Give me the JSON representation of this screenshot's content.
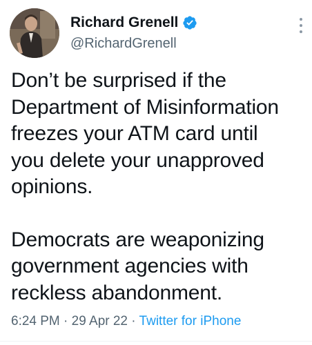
{
  "author": {
    "display_name": "Richard Grenell",
    "handle": "@RichardGrenell",
    "verified": true
  },
  "tweet": {
    "paragraphs": [
      "Don’t be surprised if the\nDepartment of Misinformation\nfreezes your ATM card until\nyou delete your unapproved\nopinions.",
      "Democrats are weaponizing\ngovernment agencies with\nreckless abandonment."
    ],
    "time": "6:24 PM",
    "separator": "·",
    "date": "29 Apr 22",
    "source": "Twitter for iPhone"
  },
  "colors": {
    "text": "#0f1419",
    "secondary": "#536471",
    "accent": "#1d9bf0"
  },
  "icons": {
    "verified": "verified-badge-icon",
    "more": "more-options-icon"
  }
}
